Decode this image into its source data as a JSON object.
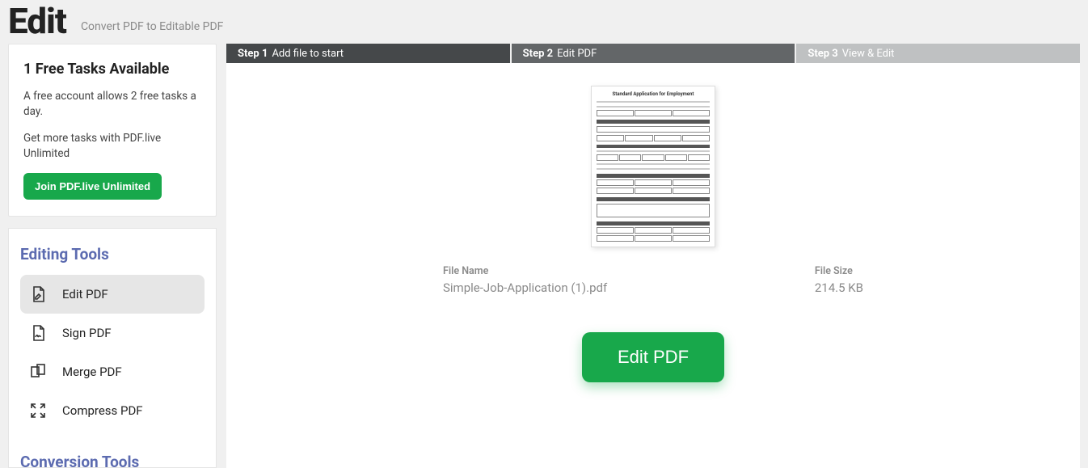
{
  "header": {
    "title": "Edit",
    "subtitle": "Convert PDF to Editable PDF"
  },
  "upsell": {
    "title": "1 Free Tasks Available",
    "line1": "A free account allows 2 free tasks a day.",
    "line2": "Get more tasks with PDF.live Unlimited",
    "button": "Join PDF.live Unlimited"
  },
  "tools": {
    "editing_heading": "Editing Tools",
    "conversion_heading": "Conversion Tools",
    "items": [
      {
        "label": "Edit PDF"
      },
      {
        "label": "Sign PDF"
      },
      {
        "label": "Merge PDF"
      },
      {
        "label": "Compress PDF"
      }
    ]
  },
  "steps": {
    "s1": {
      "bold": "Step 1",
      "rest": "Add file to start"
    },
    "s2": {
      "bold": "Step 2",
      "rest": "Edit PDF"
    },
    "s3": {
      "bold": "Step 3",
      "rest": "View & Edit"
    }
  },
  "preview": {
    "doc_title": "Standard Application for Employment"
  },
  "file": {
    "name_label": "File Name",
    "name_value": "Simple-Job-Application (1).pdf",
    "size_label": "File Size",
    "size_value": "214.5 KB"
  },
  "action": {
    "edit_button": "Edit PDF"
  }
}
